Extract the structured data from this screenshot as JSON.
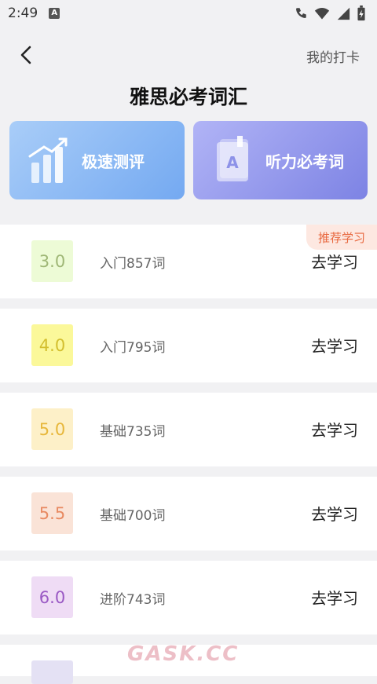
{
  "status": {
    "time": "2:49",
    "notif_icon": "A"
  },
  "header": {
    "back_icon": "chevron-left-icon",
    "checkin_label": "我的打卡",
    "title": "雅思必考词汇"
  },
  "cards": [
    {
      "label": "极速测评",
      "icon": "bar-chart-icon",
      "color_from": "#a9cdf8",
      "color_to": "#74a9f1"
    },
    {
      "label": "听力必考词",
      "icon": "book-icon",
      "color_from": "#b1b4f6",
      "color_to": "#7d83e4"
    }
  ],
  "recommend_label": "推荐学习",
  "levels": [
    {
      "score": "3.0",
      "label": "入门857词",
      "action": "去学习",
      "bg": "#edfbd6",
      "fg": "#9fb776"
    },
    {
      "score": "4.0",
      "label": "入门795词",
      "action": "去学习",
      "bg": "#fbf89a",
      "fg": "#d3bf2f"
    },
    {
      "score": "5.0",
      "label": "基础735词",
      "action": "去学习",
      "bg": "#fdf0c8",
      "fg": "#e7b73b"
    },
    {
      "score": "5.5",
      "label": "基础700词",
      "action": "去学习",
      "bg": "#fae3d7",
      "fg": "#e88a62"
    },
    {
      "score": "6.0",
      "label": "进阶743词",
      "action": "去学习",
      "bg": "#efdcf5",
      "fg": "#9a59c4"
    }
  ],
  "watermark": "GASK.CC"
}
